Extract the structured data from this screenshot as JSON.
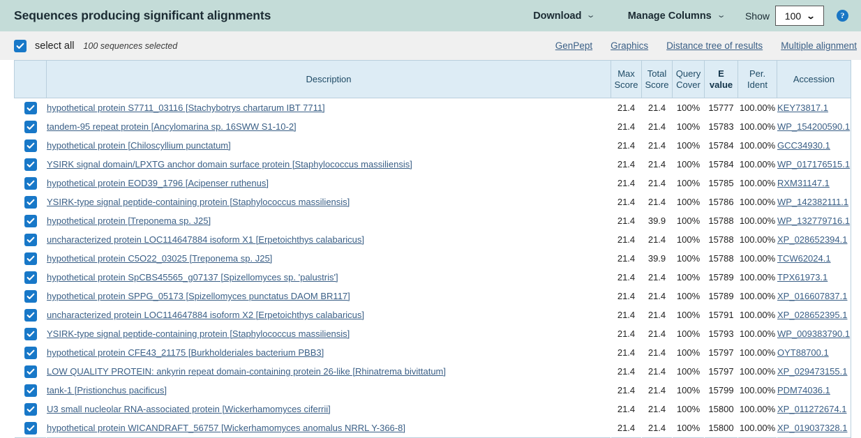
{
  "header": {
    "title": "Sequences producing significant alignments",
    "download_label": "Download",
    "manage_columns_label": "Manage Columns",
    "show_label": "Show",
    "show_value": "100",
    "caret_glyph": "⌄",
    "select_caret_glyph": "⌄",
    "help_glyph": "?",
    "bar_color": "#c4dcd8"
  },
  "select_band": {
    "select_all_label": "select all",
    "selected_count": "100 sequences selected",
    "checkbox_checked": true,
    "links": [
      {
        "label": "GenPept"
      },
      {
        "label": "Graphics"
      },
      {
        "label": "Distance tree of results"
      },
      {
        "label": "Multiple alignment"
      }
    ],
    "link_color": "#3a5f86"
  },
  "table": {
    "columns": [
      {
        "key": "select",
        "label": ""
      },
      {
        "key": "description",
        "label": "Description"
      },
      {
        "key": "max_score",
        "label": "Max\nScore"
      },
      {
        "key": "total_score",
        "label": "Total\nScore"
      },
      {
        "key": "query_cover",
        "label": "Query\nCover"
      },
      {
        "key": "e_value",
        "label": "E\nvalue"
      },
      {
        "key": "per_ident",
        "label": "Per.\nIdent"
      },
      {
        "key": "accession",
        "label": "Accession"
      }
    ],
    "column_labels": {
      "description": "Description",
      "max_score_l1": "Max",
      "max_score_l2": "Score",
      "total_score_l1": "Total",
      "total_score_l2": "Score",
      "query_cover_l1": "Query",
      "query_cover_l2": "Cover",
      "e_value_l1": "E",
      "e_value_l2": "value",
      "per_ident_l1": "Per.",
      "per_ident_l2": "Ident",
      "accession": "Accession"
    },
    "header_bg": "#ddecf5",
    "rows": [
      {
        "checked": true,
        "description": "hypothetical protein S7711_03116 [Stachybotrys chartarum IBT 7711]",
        "max_score": "21.4",
        "total_score": "21.4",
        "query_cover": "100%",
        "e_value": "15777",
        "per_ident": "100.00%",
        "accession": "KEY73817.1"
      },
      {
        "checked": true,
        "description": "tandem-95 repeat protein [Ancylomarina sp. 16SWW S1-10-2]",
        "max_score": "21.4",
        "total_score": "21.4",
        "query_cover": "100%",
        "e_value": "15783",
        "per_ident": "100.00%",
        "accession": "WP_154200590.1"
      },
      {
        "checked": true,
        "description": "hypothetical protein [Chiloscyllium punctatum]",
        "max_score": "21.4",
        "total_score": "21.4",
        "query_cover": "100%",
        "e_value": "15784",
        "per_ident": "100.00%",
        "accession": "GCC34930.1"
      },
      {
        "checked": true,
        "description": "YSIRK signal domain/LPXTG anchor domain surface protein [Staphylococcus massiliensis]",
        "max_score": "21.4",
        "total_score": "21.4",
        "query_cover": "100%",
        "e_value": "15784",
        "per_ident": "100.00%",
        "accession": "WP_017176515.1"
      },
      {
        "checked": true,
        "description": "hypothetical protein EOD39_1796 [Acipenser ruthenus]",
        "max_score": "21.4",
        "total_score": "21.4",
        "query_cover": "100%",
        "e_value": "15785",
        "per_ident": "100.00%",
        "accession": "RXM31147.1"
      },
      {
        "checked": true,
        "description": "YSIRK-type signal peptide-containing protein [Staphylococcus massiliensis]",
        "max_score": "21.4",
        "total_score": "21.4",
        "query_cover": "100%",
        "e_value": "15786",
        "per_ident": "100.00%",
        "accession": "WP_142382111.1"
      },
      {
        "checked": true,
        "description": "hypothetical protein [Treponema sp. J25]",
        "max_score": "21.4",
        "total_score": "39.9",
        "query_cover": "100%",
        "e_value": "15788",
        "per_ident": "100.00%",
        "accession": "WP_132779716.1"
      },
      {
        "checked": true,
        "description": "uncharacterized protein LOC114647884 isoform X1 [Erpetoichthys calabaricus]",
        "max_score": "21.4",
        "total_score": "21.4",
        "query_cover": "100%",
        "e_value": "15788",
        "per_ident": "100.00%",
        "accession": "XP_028652394.1"
      },
      {
        "checked": true,
        "description": "hypothetical protein C5O22_03025 [Treponema sp. J25]",
        "max_score": "21.4",
        "total_score": "39.9",
        "query_cover": "100%",
        "e_value": "15788",
        "per_ident": "100.00%",
        "accession": "TCW62024.1"
      },
      {
        "checked": true,
        "description": "hypothetical protein SpCBS45565_g07137 [Spizellomyces sp. 'palustris']",
        "max_score": "21.4",
        "total_score": "21.4",
        "query_cover": "100%",
        "e_value": "15789",
        "per_ident": "100.00%",
        "accession": "TPX61973.1"
      },
      {
        "checked": true,
        "description": "hypothetical protein SPPG_05173 [Spizellomyces punctatus DAOM BR117]",
        "max_score": "21.4",
        "total_score": "21.4",
        "query_cover": "100%",
        "e_value": "15789",
        "per_ident": "100.00%",
        "accession": "XP_016607837.1"
      },
      {
        "checked": true,
        "description": "uncharacterized protein LOC114647884 isoform X2 [Erpetoichthys calabaricus]",
        "max_score": "21.4",
        "total_score": "21.4",
        "query_cover": "100%",
        "e_value": "15791",
        "per_ident": "100.00%",
        "accession": "XP_028652395.1"
      },
      {
        "checked": true,
        "description": "YSIRK-type signal peptide-containing protein [Staphylococcus massiliensis]",
        "max_score": "21.4",
        "total_score": "21.4",
        "query_cover": "100%",
        "e_value": "15793",
        "per_ident": "100.00%",
        "accession": "WP_009383790.1"
      },
      {
        "checked": true,
        "description": "hypothetical protein CFE43_21175 [Burkholderiales bacterium PBB3]",
        "max_score": "21.4",
        "total_score": "21.4",
        "query_cover": "100%",
        "e_value": "15797",
        "per_ident": "100.00%",
        "accession": "OYT88700.1"
      },
      {
        "checked": true,
        "description": "LOW QUALITY PROTEIN: ankyrin repeat domain-containing protein 26-like [Rhinatrema bivittatum]",
        "max_score": "21.4",
        "total_score": "21.4",
        "query_cover": "100%",
        "e_value": "15797",
        "per_ident": "100.00%",
        "accession": "XP_029473155.1"
      },
      {
        "checked": true,
        "description": "tank-1 [Pristionchus pacificus]",
        "max_score": "21.4",
        "total_score": "21.4",
        "query_cover": "100%",
        "e_value": "15799",
        "per_ident": "100.00%",
        "accession": "PDM74036.1"
      },
      {
        "checked": true,
        "description": "U3 small nucleolar RNA-associated protein [Wickerhamomyces ciferrii]",
        "max_score": "21.4",
        "total_score": "21.4",
        "query_cover": "100%",
        "e_value": "15800",
        "per_ident": "100.00%",
        "accession": "XP_011272674.1"
      },
      {
        "checked": true,
        "description": "hypothetical protein WICANDRAFT_56757 [Wickerhamomyces anomalus NRRL Y-366-8]",
        "max_score": "21.4",
        "total_score": "21.4",
        "query_cover": "100%",
        "e_value": "15800",
        "per_ident": "100.00%",
        "accession": "XP_019037328.1"
      }
    ]
  }
}
